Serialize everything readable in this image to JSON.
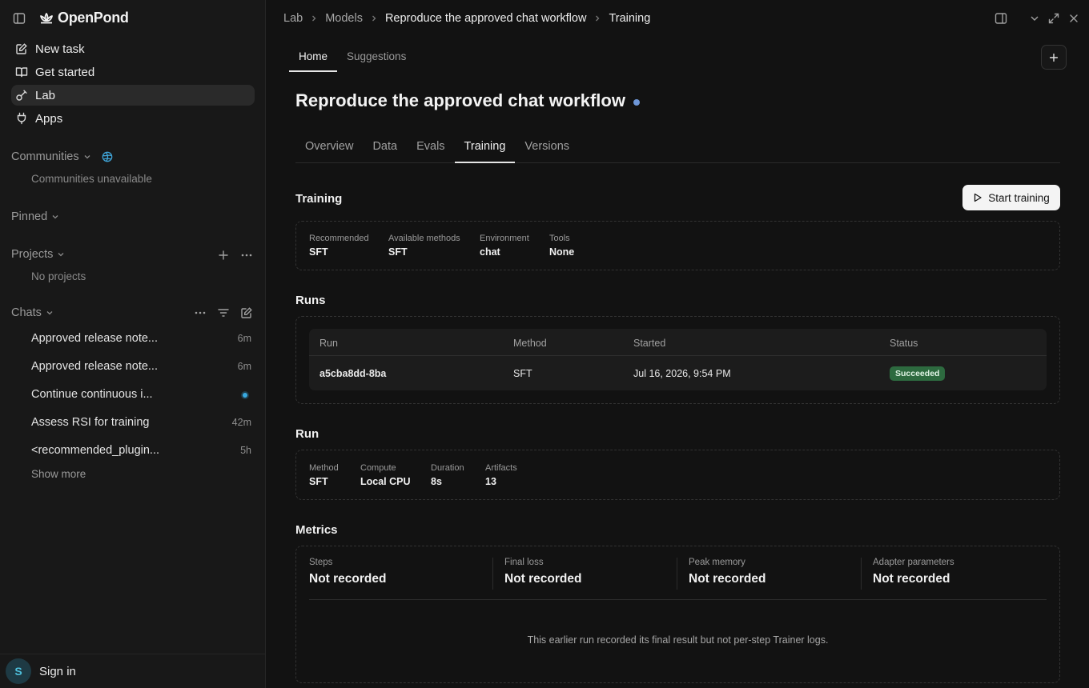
{
  "app": {
    "name": "OpenPond"
  },
  "sidebar": {
    "nav": [
      {
        "label": "New task",
        "icon": "edit-square-icon"
      },
      {
        "label": "Get started",
        "icon": "book-open-icon"
      },
      {
        "label": "Lab",
        "icon": "flask-icon",
        "active": true
      },
      {
        "label": "Apps",
        "icon": "plug-icon"
      }
    ],
    "communities": {
      "label": "Communities",
      "empty": "Communities unavailable"
    },
    "pinned": {
      "label": "Pinned"
    },
    "projects": {
      "label": "Projects",
      "empty": "No projects"
    },
    "chats": {
      "label": "Chats",
      "items": [
        {
          "title": "Approved release note...",
          "time": "6m"
        },
        {
          "title": "Approved release note...",
          "time": "6m"
        },
        {
          "title": "Continue continuous i...",
          "time": "",
          "running": true
        },
        {
          "title": "Assess RSI for training",
          "time": "42m"
        },
        {
          "title": "<recommended_plugin...",
          "time": "5h"
        }
      ],
      "show_more": "Show more"
    },
    "user": {
      "initial": "S",
      "sign_in": "Sign in"
    }
  },
  "breadcrumb": [
    "Lab",
    "Models",
    "Reproduce the approved chat workflow",
    "Training"
  ],
  "top_tabs": [
    {
      "label": "Home",
      "active": true
    },
    {
      "label": "Suggestions"
    }
  ],
  "page": {
    "title": "Reproduce the approved chat workflow",
    "tabs": [
      {
        "label": "Overview"
      },
      {
        "label": "Data"
      },
      {
        "label": "Evals"
      },
      {
        "label": "Training",
        "active": true
      },
      {
        "label": "Versions"
      }
    ]
  },
  "training": {
    "title": "Training",
    "start_button": "Start training",
    "fields": [
      {
        "label": "Recommended",
        "value": "SFT"
      },
      {
        "label": "Available methods",
        "value": "SFT"
      },
      {
        "label": "Environment",
        "value": "chat"
      },
      {
        "label": "Tools",
        "value": "None"
      }
    ]
  },
  "runs": {
    "title": "Runs",
    "columns": [
      "Run",
      "Method",
      "Started",
      "Status"
    ],
    "rows": [
      {
        "run": "a5cba8dd-8ba",
        "method": "SFT",
        "started": "Jul 16, 2026, 9:54 PM",
        "status": "Succeeded"
      }
    ]
  },
  "run": {
    "title": "Run",
    "fields": [
      {
        "label": "Method",
        "value": "SFT"
      },
      {
        "label": "Compute",
        "value": "Local CPU"
      },
      {
        "label": "Duration",
        "value": "8s"
      },
      {
        "label": "Artifacts",
        "value": "13"
      }
    ]
  },
  "metrics": {
    "title": "Metrics",
    "items": [
      {
        "label": "Steps",
        "value": "Not recorded"
      },
      {
        "label": "Final loss",
        "value": "Not recorded"
      },
      {
        "label": "Peak memory",
        "value": "Not recorded"
      },
      {
        "label": "Adapter parameters",
        "value": "Not recorded"
      }
    ],
    "note": "This earlier run recorded its final result but not per-step Trainer logs."
  },
  "colors": {
    "accent_dot": "#6e97d8",
    "success": "#2d6a3f",
    "running": "#38a9e0"
  }
}
